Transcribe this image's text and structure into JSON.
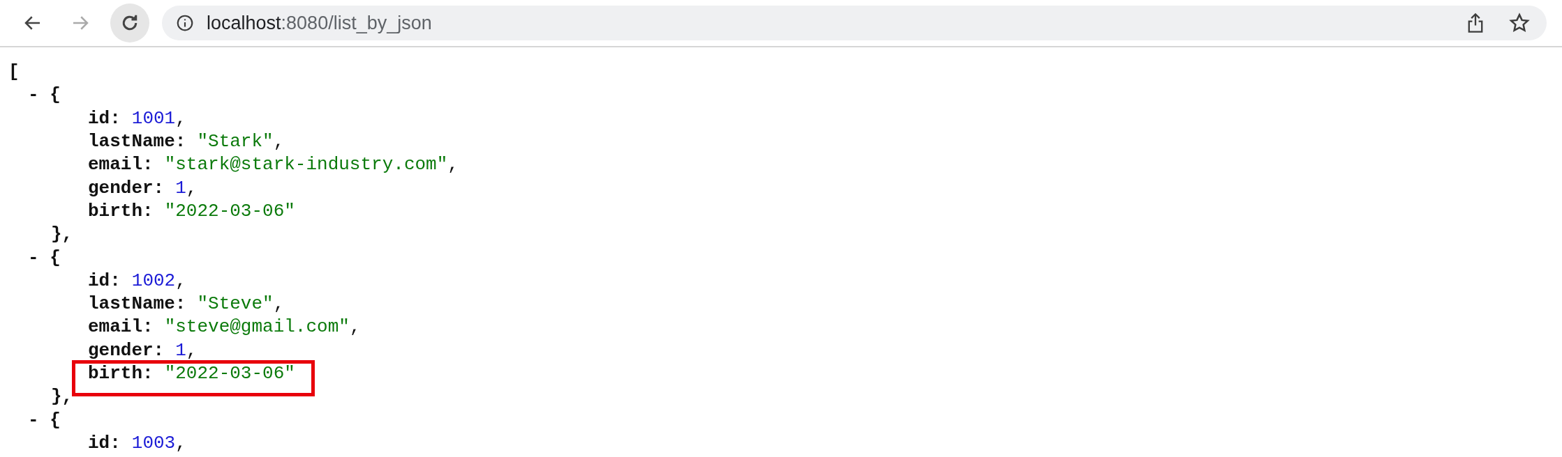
{
  "toolbar": {
    "back": {
      "disabled": false
    },
    "forward": {
      "disabled": true
    },
    "reload": {
      "hovered": true
    },
    "address": {
      "host": "localhost",
      "rest": ":8080/list_by_json"
    }
  },
  "document": {
    "open": "[",
    "items": [
      {
        "open": "- {",
        "close": "},",
        "fields": [
          {
            "key": "id:",
            "value": "1001",
            "kind": "number",
            "suffix": ",",
            "highlight": false
          },
          {
            "key": "lastName:",
            "value": "\"Stark\"",
            "kind": "string",
            "suffix": ",",
            "highlight": false
          },
          {
            "key": "email:",
            "value": "\"stark@stark-industry.com\"",
            "kind": "string",
            "suffix": ",",
            "highlight": false
          },
          {
            "key": "gender:",
            "value": "1",
            "kind": "number",
            "suffix": ",",
            "highlight": false
          },
          {
            "key": "birth:",
            "value": "\"2022-03-06\"",
            "kind": "string",
            "highlight": false
          }
        ]
      },
      {
        "open": "- {",
        "close": "},",
        "fields": [
          {
            "key": "id:",
            "value": "1002",
            "kind": "number",
            "suffix": ",",
            "highlight": false
          },
          {
            "key": "lastName:",
            "value": "\"Steve\"",
            "kind": "string",
            "suffix": ",",
            "highlight": false
          },
          {
            "key": "email:",
            "value": "\"steve@gmail.com\"",
            "kind": "string",
            "suffix": ",",
            "highlight": false
          },
          {
            "key": "gender:",
            "value": "1",
            "kind": "number",
            "suffix": ",",
            "highlight": false
          },
          {
            "key": "birth:",
            "value": "\"2022-03-06\"",
            "kind": "string",
            "highlight": true
          }
        ]
      },
      {
        "open": "- {",
        "fields": [
          {
            "key": "id:",
            "value": "1003",
            "kind": "number",
            "suffix": ",",
            "highlight": false
          }
        ]
      }
    ]
  }
}
